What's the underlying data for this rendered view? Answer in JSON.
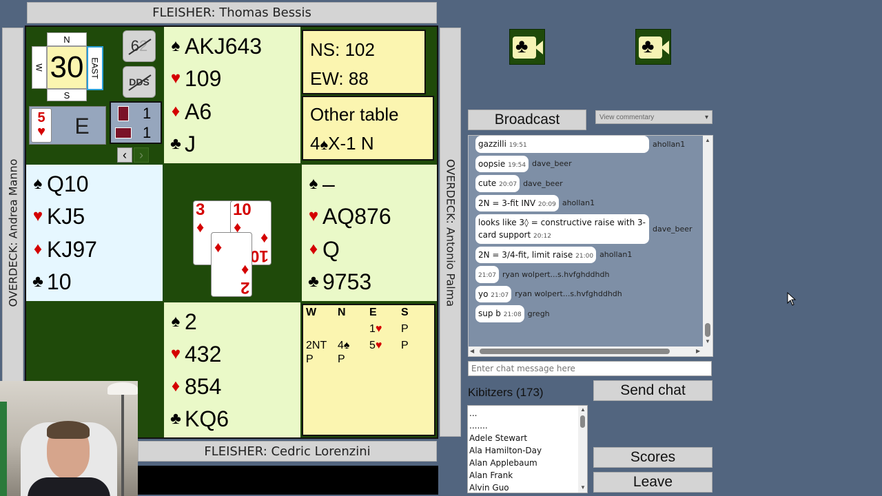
{
  "north_bar": "FLEISHER: Thomas Bessis",
  "south_bar": "FLEISHER: Cedric Lorenzini",
  "west_bar": "OVERDECK: Andrea Manno",
  "east_bar": "OVERDECK: Antonio Palma",
  "compass": {
    "n": "N",
    "s": "S",
    "w": "W",
    "e": "EAST",
    "board": "30"
  },
  "tool_buttons": {
    "undo": "6",
    "undo_ghost": "2",
    "dds": "DDS"
  },
  "contract": {
    "level": "5",
    "suit": "♥",
    "declarer": "E"
  },
  "tricks": {
    "ns": "1",
    "ew": "1"
  },
  "nav": {
    "prev": "‹",
    "next": "›"
  },
  "score": {
    "ns": "NS:  102",
    "ew": "EW: 88"
  },
  "other_table": {
    "title": "Other table",
    "result_level": "4",
    "result_suit": "♠",
    "result_rest": "X-1 N"
  },
  "suits": {
    "spade": "♠",
    "heart": "♥",
    "diamond": "♦",
    "club": "♣"
  },
  "north": {
    "spades": "AKJ643",
    "hearts": "109",
    "diamonds": "A6",
    "clubs": "J"
  },
  "west": {
    "spades": "Q10",
    "hearts": "KJ5",
    "diamonds": "KJ97",
    "clubs": "10"
  },
  "east": {
    "spades": "–",
    "hearts": "AQ876",
    "diamonds": "Q",
    "clubs": "9753"
  },
  "south": {
    "spades": "2",
    "hearts": "432",
    "diamonds": "854",
    "clubs": "KQ6"
  },
  "trick_cards": [
    {
      "rank": "3",
      "suit": "♦"
    },
    {
      "rank": "10",
      "suit": "♦"
    },
    {
      "rank": "2",
      "suit": "♦"
    }
  ],
  "bidding": {
    "headers": [
      "W",
      "N",
      "E",
      "S"
    ],
    "b1": "1",
    "b1s": "♥",
    "b2": "P",
    "b3": "2NT",
    "b4": "4",
    "b4s": "♠",
    "b5": "5",
    "b5s": "♥",
    "b6": "P",
    "b7": "P",
    "b8": "P"
  },
  "broadcast": "Broadcast",
  "commentary_select": "View commentary",
  "chat": [
    {
      "text": "gazzilli",
      "time": "19:51",
      "author": "ahollan1"
    },
    {
      "text": "oopsie",
      "time": "19:54",
      "author": "dave_beer"
    },
    {
      "text": "cute",
      "time": "20:07",
      "author": "dave_beer"
    },
    {
      "text": "2N = 3-fit INV",
      "time": "20:09",
      "author": "ahollan1"
    },
    {
      "text": "looks like 3◊ = constructive raise with 3-card support",
      "time": "20:12",
      "author": "dave_beer"
    },
    {
      "text": "2N = 3/4-fit, limit raise",
      "time": "21:00",
      "author": "ahollan1"
    },
    {
      "text": "",
      "time": "21:07",
      "author": "ryan wolpert...s.hvfghddhdh"
    },
    {
      "text": "yo",
      "time": "21:07",
      "author": "ryan wolpert...s.hvfghddhdh"
    },
    {
      "text": "sup b",
      "time": "21:08",
      "author": "gregh"
    }
  ],
  "chat_placeholder": "Enter chat message here",
  "send_chat": "Send chat",
  "kibitzers_label": "Kibitzers (173)",
  "kibitzers": [
    "...",
    ".......",
    "Adele Stewart",
    "Ala Hamilton-Day",
    "Alan Applebaum",
    "Alan Frank",
    "Alvin Guo"
  ],
  "scores_button": "Scores",
  "leave_button": "Leave",
  "colors": {
    "background": "#52657f",
    "felt": "#1f4a0a",
    "hand": "#eaf9c8",
    "west_hand": "#e6f7ff",
    "score_panel": "#fbf5b0"
  },
  "icons": [
    "club-camera-icon",
    "club-camera-icon",
    "scrollbar",
    "mouse-cursor"
  ]
}
